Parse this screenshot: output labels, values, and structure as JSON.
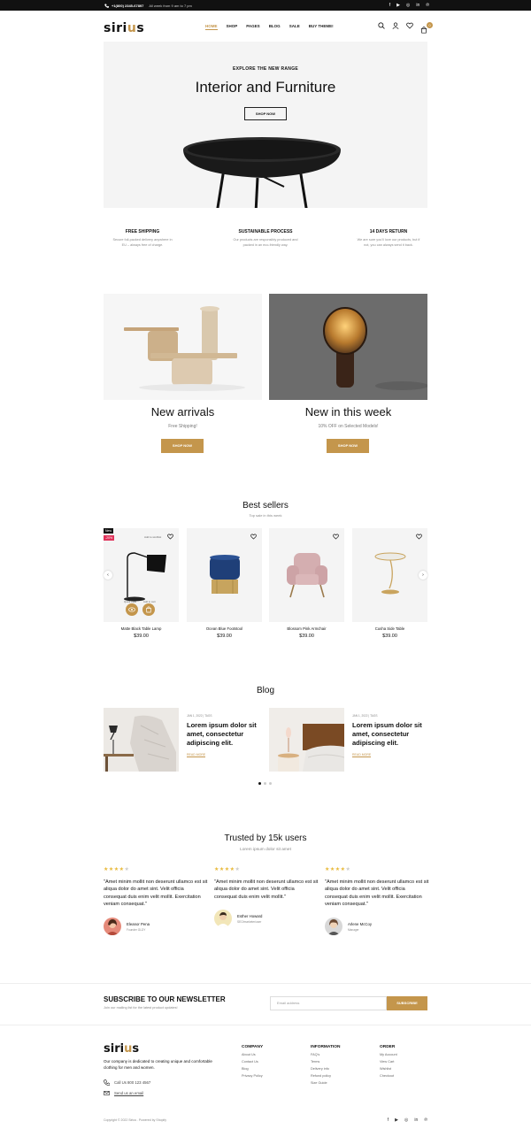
{
  "topbar": {
    "phone": "+1(800) 2345-67897",
    "hours": "All week from 9 am to 7 pm",
    "social": [
      "facebook-icon",
      "youtube-icon",
      "instagram-icon",
      "linkedin-icon",
      "pinterest-icon"
    ]
  },
  "header": {
    "logo_main": "siri",
    "logo_accent": "u",
    "logo_end": "s",
    "nav": [
      "HOME",
      "SHOP",
      "PAGES",
      "BLOG",
      "SALE",
      "BUY THEME!"
    ],
    "active_nav": "HOME",
    "cart_count": "0"
  },
  "hero": {
    "eyebrow": "EXPLORE THE NEW RANGE",
    "title": "Interior and Furniture",
    "button": "SHOP NOW"
  },
  "features": [
    {
      "title": "FREE SHIPPING",
      "text1": "Secure foil-packed delivery anywhere in",
      "text2": "EU – always free of charge."
    },
    {
      "title": "SUSTAINABLE PROCESS",
      "text1": "Our products are responsibly produced and",
      "text2": "packed in an eco-friendly way."
    },
    {
      "title": "14 DAYS RETURN",
      "text1": "We are sure you'll love our products, but if",
      "text2": "not, you can always send it back."
    }
  ],
  "promos": [
    {
      "title": "New arrivals",
      "subtitle": "Free Shipping!",
      "button": "SHOP NOW"
    },
    {
      "title": "New in this week",
      "subtitle": "10% OFF on Selected Models!",
      "button": "SHOP NOW"
    }
  ],
  "bestsellers": {
    "title": "Best sellers",
    "subtitle": "Top sale in this week",
    "products": [
      {
        "name": "Matte Black Table Lamp",
        "price": "$39.00",
        "badge_new": "New",
        "badge_sale": "-20%",
        "wishlist_label": "Add to wishlist",
        "quick_view": "Quick View",
        "add_to_cart": "Add to cart"
      },
      {
        "name": "Ocean Blue Footstool",
        "price": "$39.00"
      },
      {
        "name": "Blossom Pink Armchair",
        "price": "$39.00"
      },
      {
        "name": "Cusha Side Table",
        "price": "$39.00"
      }
    ]
  },
  "blog": {
    "title": "Blog",
    "posts": [
      {
        "meta": "JAN 1, 2022 | TAGS",
        "title": "Lorem ipsum dolor sit amet, consectetur adipiscing elit.",
        "read": "READ MORE"
      },
      {
        "meta": "JAN 1, 2022 | TAGS",
        "title": "Lorem ipsum dolor sit amet, consectetur adipiscing elit.",
        "read": "READ MORE"
      }
    ]
  },
  "testimonials": {
    "title": "Trusted by 15k users",
    "subtitle": "Lorem ipsum dolor sit amet",
    "items": [
      {
        "stars": 4,
        "quote": "\"Amet minim mollit non deserunt ullamco est sit aliqua dolor do amet sint. Velit officia consequat duis enim velit mollit. Exercitation veniam consequat.\"",
        "name": "Eleanor Pena",
        "role": "Founder GLDY"
      },
      {
        "stars": 4,
        "quote": "\"Amet minim mollit non deserunt ullamco est sit aliqua dolor do amet sint. Velit officia consequat duis enim velit mollit.\"",
        "name": "Esther Howard",
        "role": "SEO/marketer/user"
      },
      {
        "stars": 4,
        "quote": "\"Amet minim mollit non deserunt ullamco est sit aliqua dolor do amet sint. Velit officia consequat duis enim velit mollit. Exercitation veniam consequat.\"",
        "name": "Arlene McCoy",
        "role": "Manager"
      }
    ]
  },
  "newsletter": {
    "title": "SUBSCRIBE TO OUR NEWSLETTER",
    "subtitle": "Join our mailing list for the latest product updates!",
    "placeholder": "Email address",
    "button": "SUBSCRIBE"
  },
  "footer": {
    "description": "Our company is dedicated to creating unique and comfortable clothing for men and women.",
    "phone": "Call Us 800 123 4567",
    "email": "Send us an email",
    "columns": [
      {
        "title": "COMPANY",
        "links": [
          "About Us",
          "Contact Us",
          "Blog",
          "Privacy Policy"
        ]
      },
      {
        "title": "INFORMATION",
        "links": [
          "FAQ's",
          "Terms",
          "Delivery info",
          "Refund policy",
          "Size Guide"
        ]
      },
      {
        "title": "ORDER",
        "links": [
          "My Account",
          "View Cart",
          "Wishlist",
          "Checkout"
        ]
      }
    ],
    "copyright": "Copyright © 2022 Sirius . Powered by Shopify"
  },
  "colors": {
    "accent": "#c4964c",
    "dark": "#111111",
    "light_bg": "#f4f4f4"
  }
}
